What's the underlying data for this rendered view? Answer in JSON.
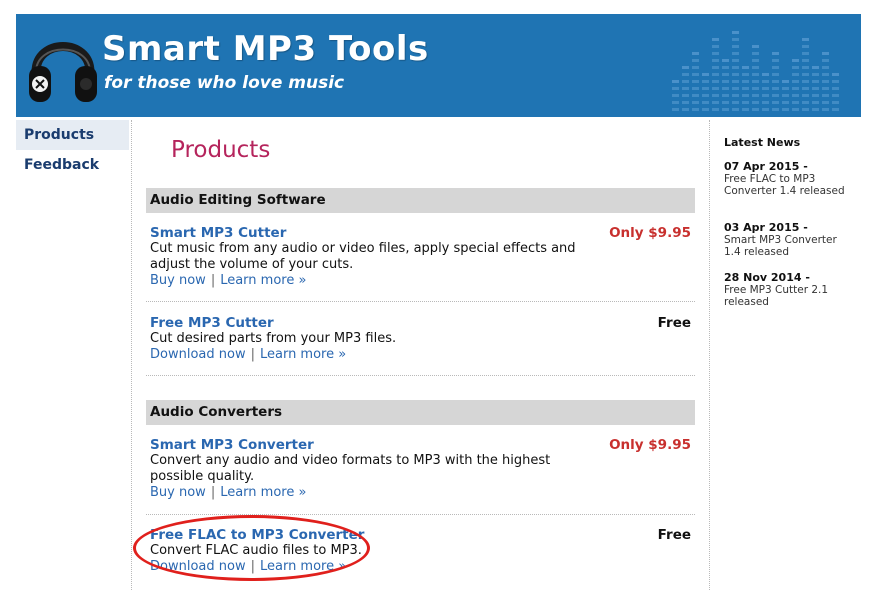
{
  "header": {
    "title": "Smart MP3 Tools",
    "tagline": "for those who love music",
    "colors": {
      "background": "#1f74b3",
      "text": "#ffffff",
      "equalizer": "#4f95cc"
    },
    "logo_icon": "headphones-icon"
  },
  "nav": {
    "items": [
      {
        "label": "Products",
        "active": true
      },
      {
        "label": "Feedback",
        "active": false
      }
    ]
  },
  "main": {
    "title": "Products",
    "title_color": "#b5245c",
    "sections": [
      {
        "title": "Audio Editing Software",
        "products": [
          {
            "name": "Smart MP3 Cutter",
            "price": "Only $9.95",
            "desc": "Cut music from any audio or video files, apply special effects and adjust the volume of your cuts.",
            "link1": "Buy now",
            "separator": "|",
            "link2": "Learn more »"
          },
          {
            "name": "Free MP3 Cutter",
            "price": "Free",
            "desc": "Cut desired parts from your MP3 files.",
            "link1": "Download now",
            "separator": "|",
            "link2": "Learn more »"
          }
        ]
      },
      {
        "title": "Audio Converters",
        "products": [
          {
            "name": "Smart MP3 Converter",
            "price": "Only $9.95",
            "desc": "Convert any audio and video formats to MP3 with the highest possible quality.",
            "link1": "Buy now",
            "separator": "|",
            "link2": "Learn more »"
          },
          {
            "name": "Free FLAC to MP3 Converter",
            "price": "Free",
            "desc": "Convert FLAC audio files to MP3.",
            "link1": "Download now",
            "separator": "|",
            "link2": "Learn more »"
          }
        ]
      }
    ],
    "colors": {
      "link": "#2a67b0",
      "price_paid": "#c8302e",
      "section_bg": "#d6d6d6",
      "highlight": "#e0201c"
    }
  },
  "news": {
    "heading": "Latest News",
    "items": [
      {
        "date": "07 Apr 2015 -",
        "text": "Free FLAC to MP3 Converter 1.4 released"
      },
      {
        "date": "03 Apr 2015 -",
        "text": "Smart MP3 Converter 1.4 released"
      },
      {
        "date": "28 Nov 2014 -",
        "text": "Free MP3 Cutter 2.1 released"
      }
    ]
  }
}
